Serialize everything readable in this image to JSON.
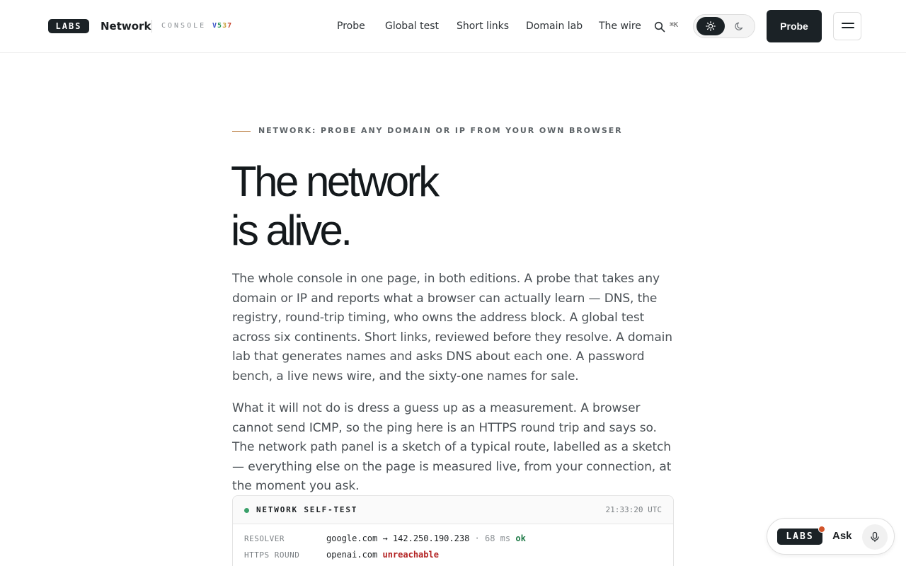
{
  "header": {
    "logo_text": "LABS",
    "brand": "Network",
    "console_label": "CONSOLE",
    "version": {
      "v": "V",
      "d1": "5",
      "d2": "3",
      "d3": "7"
    },
    "nav": [
      {
        "label": "Probe"
      },
      {
        "label": "Global test"
      },
      {
        "label": "Short links"
      },
      {
        "label": "Domain lab"
      },
      {
        "label": "The wire"
      }
    ],
    "search_shortcut": "⌘K",
    "search_icon": "search-icon",
    "theme_icons": {
      "light": "sun-icon",
      "dark": "moon-icon"
    },
    "probe_button": "Probe",
    "menu_icon": "hamburger-icon"
  },
  "hero": {
    "eyebrow": "NETWORK: PROBE ANY DOMAIN OR IP FROM YOUR OWN BROWSER",
    "headline_line1": "The network",
    "headline_line2": "is alive.",
    "paragraph1": "The whole console in one page, in both editions. A probe that takes any domain or IP and reports what a browser can actually learn — DNS, the registry, round-trip timing, who owns the address block. A global test across six continents. Short links, reviewed before they resolve. A domain lab that generates names and asks DNS about each one. A password bench, a live news wire, and the sixty-one names for sale.",
    "paragraph2": "What it will not do is dress a guess up as a measurement. A browser cannot send ICMP, so the ping here is an HTTPS round trip and says so. The network path panel is a sketch of a typical route, labelled as a sketch — everything else on the page is measured live, from your connection, at the moment you ask."
  },
  "selftest": {
    "title": "NETWORK SELF-TEST",
    "time": "21:33:20 UTC",
    "rows": [
      {
        "label": "RESOLVER",
        "value": "google.com → 142.250.190.238",
        "sep": "·",
        "ms": "68 ms",
        "status": "ok"
      },
      {
        "label": "HTTPS ROUND",
        "value": "openai.com",
        "status": "unreachable"
      }
    ]
  },
  "ask": {
    "logo_text": "LABS",
    "label": "Ask",
    "mic_icon": "microphone-icon"
  },
  "colors": {
    "ink": "#1b2226",
    "accent_line": "#b3702e",
    "ok": "#1f7a47",
    "error": "#b32222",
    "notify": "#d2542a"
  }
}
